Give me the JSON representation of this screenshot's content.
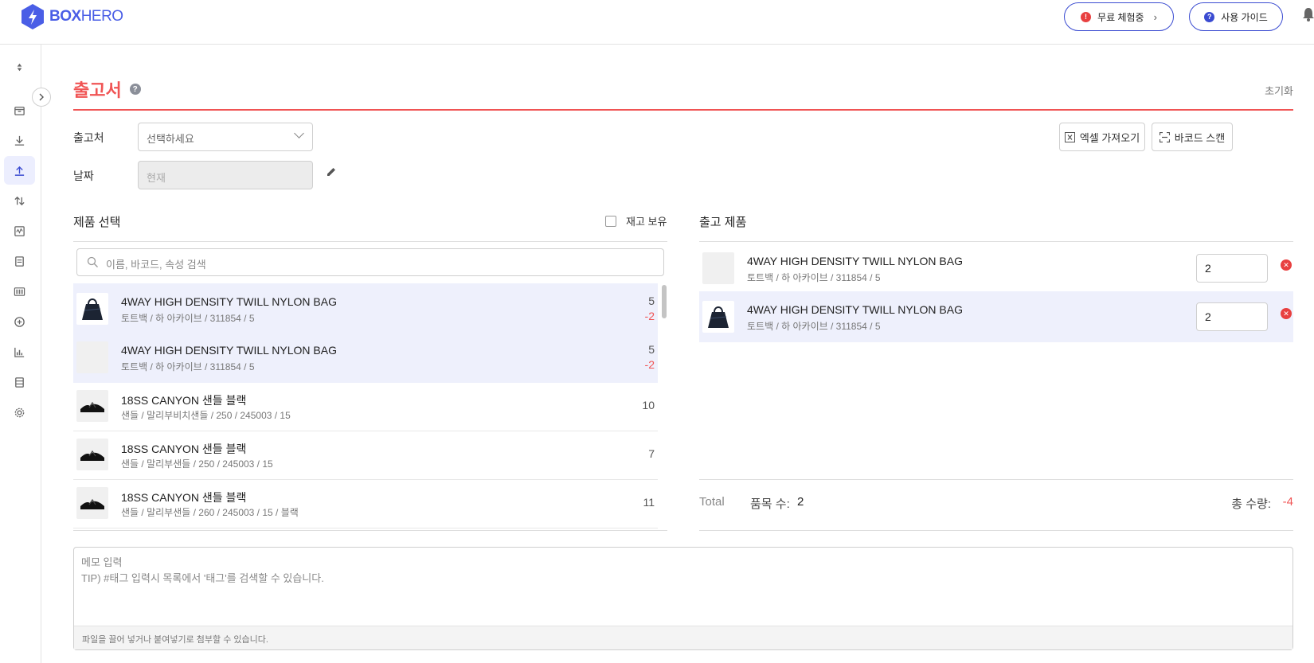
{
  "brand": {
    "name_bold": "BOX",
    "name_thin": "HERO",
    "color": "#4a5ee6"
  },
  "header": {
    "trial_label": "무료 체험중",
    "guide_label": "사용 가이드"
  },
  "sidebar": {
    "items": [
      {
        "icon": "sort-icon"
      },
      {
        "icon": "box-icon"
      },
      {
        "icon": "stock-in-icon"
      },
      {
        "icon": "stock-out-icon",
        "active": true
      },
      {
        "icon": "transfer-icon"
      },
      {
        "icon": "adjust-icon"
      },
      {
        "icon": "document-icon"
      },
      {
        "icon": "barcode-icon"
      },
      {
        "icon": "add-circle-icon"
      },
      {
        "icon": "chart-icon"
      },
      {
        "icon": "database-icon"
      },
      {
        "icon": "gear-icon"
      }
    ]
  },
  "page": {
    "title": "출고서",
    "reset_label": "초기화",
    "accent": "#f05454"
  },
  "form": {
    "destination_label": "출고처",
    "destination_placeholder": "선택하세요",
    "date_label": "날짜",
    "date_value": "현재"
  },
  "toolbar": {
    "excel_label": "엑셀 가져오기",
    "barcode_label": "바코드 스캔"
  },
  "product_select": {
    "title": "제품 선택",
    "in_stock_label": "재고 보유",
    "search_placeholder": "이름, 바코드, 속성 검색",
    "items": [
      {
        "name": "4WAY HIGH DENSITY TWILL NYLON BAG",
        "sub": "토트백 / 하 아카이브 / 311854 / 5",
        "qty": "5",
        "delta": "-2",
        "selected": true,
        "image": "bag"
      },
      {
        "name": "4WAY HIGH DENSITY TWILL NYLON BAG",
        "sub": "토트백 / 하 아카이브 / 311854 / 5",
        "qty": "5",
        "delta": "-2",
        "selected": true,
        "image": "none"
      },
      {
        "name": "18SS CANYON 샌들 블랙",
        "sub": "샌들 / 말리부비치샌들 / 250 / 245003 / 15",
        "qty": "10",
        "delta": "",
        "selected": false,
        "image": "sandal"
      },
      {
        "name": "18SS CANYON 샌들 블랙",
        "sub": "샌들 / 말리부샌들 / 250 / 245003 / 15",
        "qty": "7",
        "delta": "",
        "selected": false,
        "image": "sandal"
      },
      {
        "name": "18SS CANYON 샌들 블랙",
        "sub": "샌들 / 말리부샌들 / 260 / 245003 / 15 / 블랙",
        "qty": "11",
        "delta": "",
        "selected": false,
        "image": "sandal"
      }
    ]
  },
  "outgoing": {
    "title": "출고 제품",
    "items": [
      {
        "name": "4WAY HIGH DENSITY TWILL NYLON BAG",
        "sub": "토트백 / 하 아카이브 / 311854 / 5",
        "qty": "2",
        "image": "none",
        "selected": false
      },
      {
        "name": "4WAY HIGH DENSITY TWILL NYLON BAG",
        "sub": "토트백 / 하 아카이브 / 311854 / 5",
        "qty": "2",
        "image": "bag",
        "selected": true
      }
    ],
    "total_label": "Total",
    "item_count_label": "품목 수:",
    "item_count": "2",
    "total_qty_label": "총 수량:",
    "total_qty": "-4"
  },
  "memo": {
    "placeholder_line1": "메모 입력",
    "placeholder_line2": "TIP) #태그 입력시 목록에서 '태그'를 검색할 수 있습니다.",
    "attach_hint": "파일을 끌어 넣거나 붙여넣기로 첨부할 수 있습니다."
  }
}
